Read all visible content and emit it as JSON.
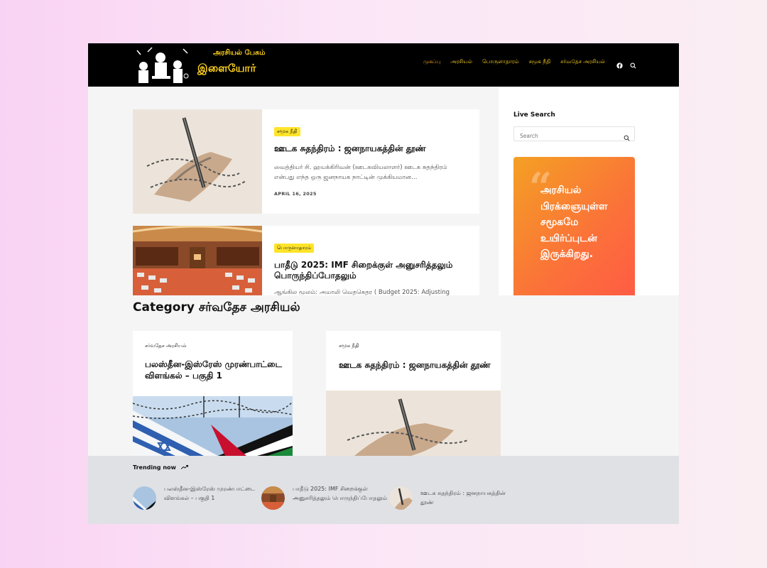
{
  "logo": {
    "line1": "அரசியல் பேசும்",
    "line2": "இளையோர்"
  },
  "nav": {
    "items": [
      "முகப்பு",
      "அரசியல்",
      "பொருளாதாரம்",
      "சமூக நீதி",
      "சர்வதேச அரசியல்"
    ],
    "active_index": 0
  },
  "header_icons": [
    "facebook-icon",
    "search-icon"
  ],
  "posts": [
    {
      "badge": "சமூக நீதி",
      "title": "ஊடக சுதந்திரம் : ஜனநாயகத்தின் தூண்",
      "excerpt": "வைத்தியர் சி. ஹயக்கிரிவன் (ஊடகவியலாளர்) ஊடக சுதந்திரம் என்பது எந்த ஒரு ஜனநாயக நாட்டின் முக்கியமான…",
      "date": "APRIL 16, 2025"
    },
    {
      "badge": "பொருளாதாரம்",
      "title": "பாதீடு 2025: IMF சிறைக்குள் அனுசரித்தலும் பொருந்திப்போதலும்",
      "excerpt": "ஆங்கில மூலம்: அமாலி வெதகெதர ( Budget 2025: Adjusting"
    }
  ],
  "sidebar": {
    "search_heading": "Live Search",
    "search_placeholder": "Search",
    "quote": "அரசியல் பிரக்ஞையுள்ள சமூகமே உயிர்ப்புடன் இருக்கிறது."
  },
  "category": {
    "title": "Category சர்வதேச அரசியல்",
    "cards": [
      {
        "cat": "சர்வதேச அரசியல்",
        "title": "பலஸ்தீன-இஸ்ரேஸ் முரண்பாட்டை விளங்கல் – பகுதி 1"
      },
      {
        "cat": "சமூக நீதி",
        "title": "ஊடக சுதந்திரம் : ஜனநாயகத்தின் தூண்"
      }
    ]
  },
  "trending": {
    "heading": "Trending now",
    "items": [
      {
        "title": "பலஸ்தீன-இஸ்ரேஸ் முரண்பாட்டை விளங்கல் – பகுதி 1"
      },
      {
        "title": "பாதீடு 2025: IMF சிறைக்குள் அனுசரித்தலும் பொருந்திப்போதலும்"
      },
      {
        "title": "ஊடக சுதந்திரம் : ஜனநாயகத்தின் தூண்"
      }
    ]
  },
  "colors": {
    "header_bg": "#000000",
    "nav_text": "#ffd21f",
    "badge_bg": "#ffe42a",
    "quote_gradient_start": "#f4a024",
    "quote_gradient_end": "#ff5b45"
  }
}
